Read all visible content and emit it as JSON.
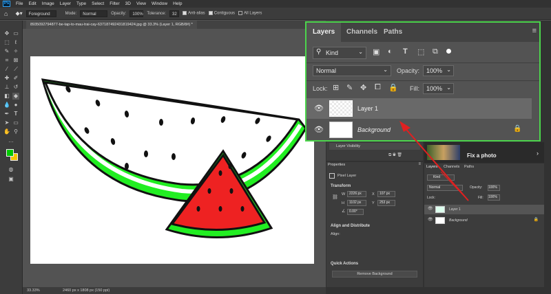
{
  "menu": [
    "File",
    "Edit",
    "Image",
    "Layer",
    "Type",
    "Select",
    "Filter",
    "3D",
    "View",
    "Window",
    "Help"
  ],
  "options_bar": {
    "fill_source": "Foreground",
    "mode_label": "Mode:",
    "mode_value": "Normal",
    "opacity_label": "Opacity:",
    "opacity_value": "100%",
    "tolerance_label": "Tolerance:",
    "tolerance_value": "32",
    "anti_alias": "Anti-alias",
    "contiguous": "Contiguous",
    "all_layers": "All Layers"
  },
  "document_tab": "8935092794877-be-tap-to-mau-trai-cay-637187492431819424.jpg @ 33.3% (Layer 1, RGB/8#) *",
  "status": {
    "zoom": "33.33%",
    "size": "2460 px x 1808 px (150 ppi)"
  },
  "layers_popout": {
    "tabs": [
      "Layers",
      "Channels",
      "Paths"
    ],
    "filter_kind": "Kind",
    "blend_mode": "Normal",
    "opacity_label": "Opacity:",
    "opacity_value": "100%",
    "lock_label": "Lock:",
    "fill_label": "Fill:",
    "fill_value": "100%",
    "layers": [
      {
        "name": "Layer 1",
        "selected": true
      },
      {
        "name": "Background",
        "selected": false
      }
    ]
  },
  "history_items": [
    "Layer Visibility"
  ],
  "properties": {
    "tab": "Properties",
    "kind": "Pixel Layer",
    "transform_title": "Transform",
    "w": "2226 px",
    "x": "107 px",
    "h": "1102 px",
    "y": "253 px",
    "angle": "0.00°",
    "align_title": "Align and Distribute",
    "align_label": "Align:",
    "quick_actions_title": "Quick Actions",
    "remove_bg": "Remove Background"
  },
  "learn": {
    "fix_photo": "Fix a photo"
  },
  "mini_layers": {
    "tabs": [
      "Layers",
      "Channels",
      "Paths"
    ],
    "kind": "Kind",
    "mode": "Normal",
    "opacity_label": "Opacity:",
    "opacity_value": "100%",
    "lock_label": "Lock:",
    "fill_label": "Fill:",
    "fill_value": "100%",
    "layers": [
      "Layer 1",
      "Background"
    ]
  },
  "colors": {
    "accent_green": "#4cd54c",
    "arrow_red": "#e02020",
    "melon_green": "#22ee22",
    "melon_red": "#ee2222"
  }
}
